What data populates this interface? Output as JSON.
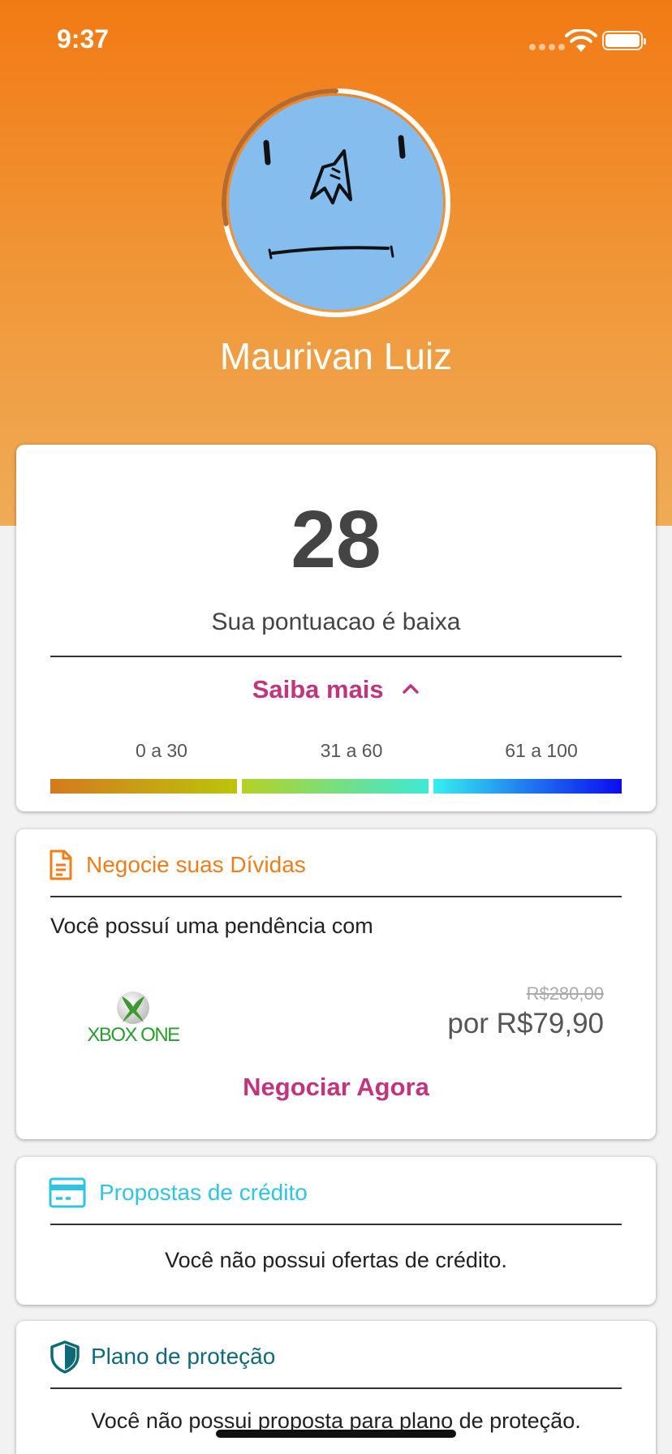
{
  "status_bar": {
    "time": "9:37"
  },
  "profile": {
    "name": "Maurivan Luiz",
    "score_ring_percent": 28
  },
  "score": {
    "value": "28",
    "caption": "Sua pontuacao é baixa",
    "saiba_mais_label": "Saiba mais",
    "ranges": [
      "0 a 30",
      "31 a 60",
      "61 a 100"
    ]
  },
  "debts": {
    "title": "Negocie suas Dívidas",
    "description": "Você possuí uma pendência com",
    "brand": "XBOX ONE",
    "old_price": "R$280,00",
    "new_price": "por R$79,90",
    "action_label": "Negociar Agora"
  },
  "credit": {
    "title": "Propostas de crédito",
    "message": "Você não possui ofertas de crédito."
  },
  "protection": {
    "title": "Plano de proteção",
    "message": "Você não possui proposta para plano de proteção."
  },
  "colors": {
    "header_top": "#f27a14",
    "header_bottom": "#efab57",
    "accent_pink": "#c0357d",
    "debt_orange": "#f07d1a",
    "credit_cyan": "#2ec4e4",
    "protection_teal": "#0f6a78",
    "avatar_blue": "#85bdee"
  },
  "icons": {
    "debt": "document-icon",
    "credit": "credit-card-icon",
    "protection": "shield-icon"
  }
}
